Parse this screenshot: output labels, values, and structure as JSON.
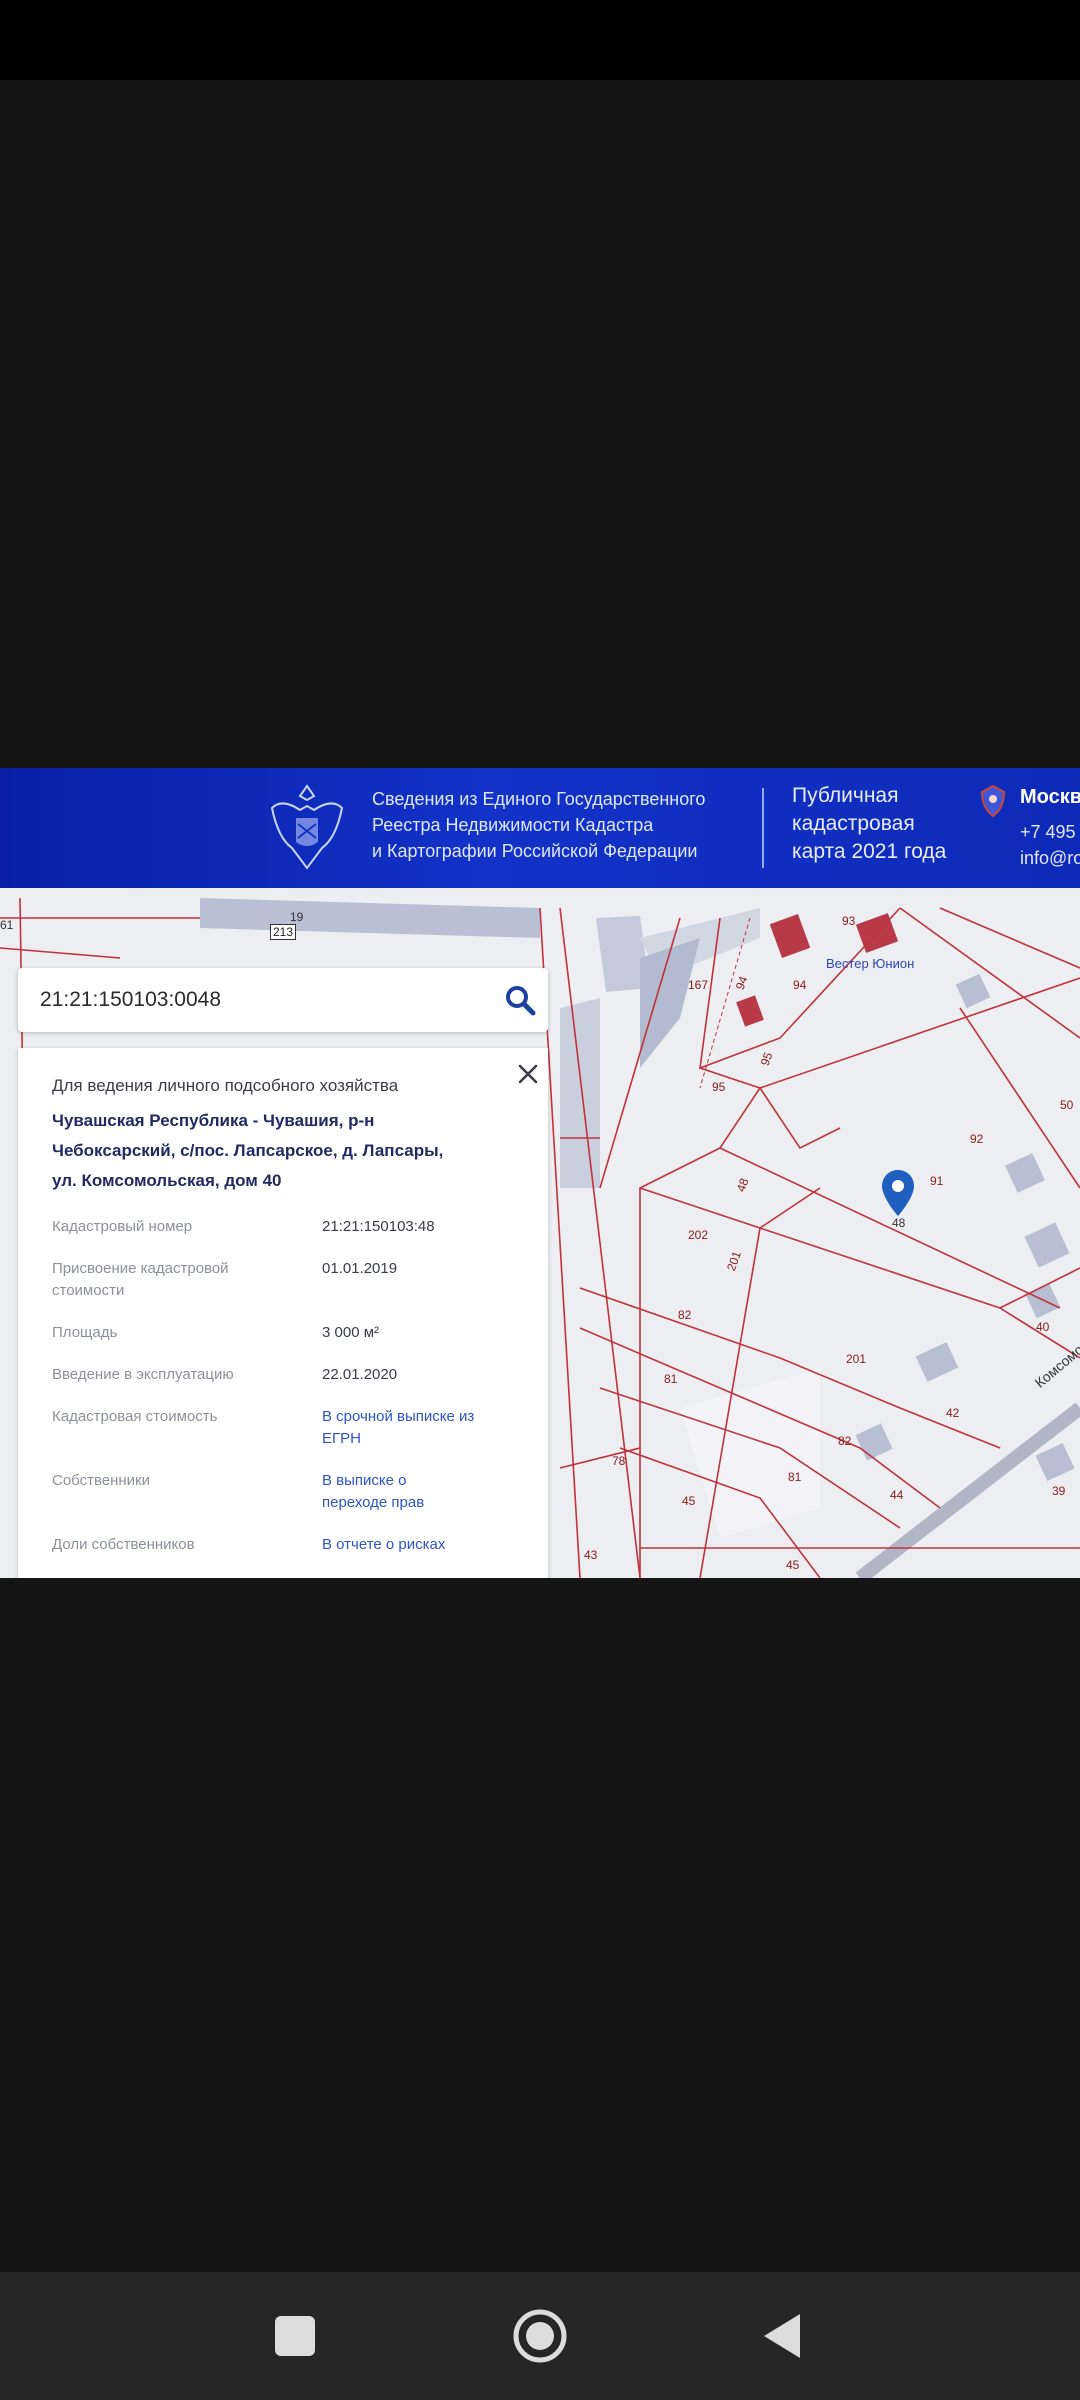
{
  "header": {
    "title_lines": [
      "Сведения из Единого Государственного",
      "Реестра Недвижимости Кадастра",
      "и Картографии Российской Федерации"
    ],
    "map_title_lines": [
      "Публичная",
      "кадастровая",
      "карта 2021 года"
    ],
    "city": "Москв",
    "phone": "+7 495 4",
    "email": "info@ro"
  },
  "search": {
    "value": "21:21:150103:0048"
  },
  "card": {
    "purpose": "Для ведения личного подсобного хозяйства",
    "address_lines": [
      "Чувашская Республика - Чувашия, р-н",
      "Чебоксарский, с/пос. Лапсарское, д. Лапсары,",
      "ул. Комсомольская, дом 40"
    ],
    "rows": [
      {
        "label": "Кадастровый номер",
        "value": "21:21:150103:48"
      },
      {
        "label": "Присвоение кадастровой стоимости",
        "value": "01.01.2019"
      },
      {
        "label": "Площадь",
        "value": "3 000 м²"
      },
      {
        "label": "Введение в эксплуатацию",
        "value": "22.01.2020"
      },
      {
        "label": "Кадастровая стоимость",
        "value": "В срочной выписке из ЕГРН"
      },
      {
        "label": "Собственники",
        "value": "В выписке о переходе прав"
      },
      {
        "label": "Доли собственников",
        "value": "В отчете о рисках"
      }
    ]
  },
  "map": {
    "labels": [
      "213",
      "19",
      "167",
      "93",
      "94",
      "94",
      "95",
      "95",
      "Вестер Юнион",
      "50",
      "92",
      "91",
      "48",
      "48",
      "202",
      "201",
      "82",
      "201",
      "81",
      "40",
      "42",
      "82",
      "78",
      "81",
      "45",
      "44",
      "39",
      "43",
      "45",
      "Комсомо",
      "61"
    ],
    "marker_label": "48"
  },
  "colors": {
    "header_blue": "#1232c8",
    "parcel_line": "#c0323c",
    "link": "#2d54c8",
    "marker": "#1e5fbf"
  },
  "nav": {
    "recents_icon": "square-icon",
    "home_icon": "circle-icon",
    "back_icon": "triangle-icon"
  }
}
